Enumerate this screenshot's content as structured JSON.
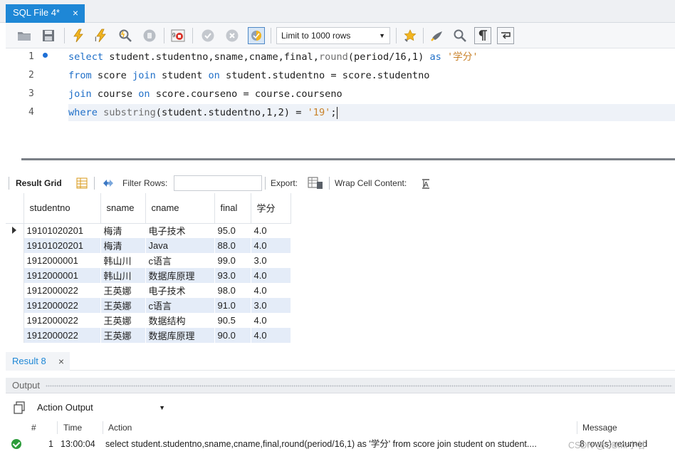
{
  "tab": {
    "title": "SQL File 4*",
    "close": "×"
  },
  "toolbar": {
    "limit_value": "Limit to 1000 rows"
  },
  "editor": {
    "line_numbers": [
      "1",
      "2",
      "3",
      "4"
    ],
    "lines": [
      [
        {
          "t": "select",
          "c": "kw"
        },
        {
          "t": " student.studentno,sname,cname,final,",
          "c": ""
        },
        {
          "t": "round",
          "c": "fn"
        },
        {
          "t": "(period/16,1) ",
          "c": ""
        },
        {
          "t": "as",
          "c": "kw"
        },
        {
          "t": " ",
          "c": ""
        },
        {
          "t": "'学分'",
          "c": "str"
        }
      ],
      [
        {
          "t": "from",
          "c": "kw"
        },
        {
          "t": " score ",
          "c": ""
        },
        {
          "t": "join",
          "c": "kw"
        },
        {
          "t": " student ",
          "c": ""
        },
        {
          "t": "on",
          "c": "kw"
        },
        {
          "t": " student.studentno = score.studentno",
          "c": ""
        }
      ],
      [
        {
          "t": "join",
          "c": "kw"
        },
        {
          "t": " course ",
          "c": ""
        },
        {
          "t": "on",
          "c": "kw"
        },
        {
          "t": " score.courseno = course.courseno",
          "c": ""
        }
      ],
      [
        {
          "t": "where",
          "c": "kw"
        },
        {
          "t": " ",
          "c": ""
        },
        {
          "t": "substring",
          "c": "fn"
        },
        {
          "t": "(student.studentno,1,2) = ",
          "c": ""
        },
        {
          "t": "'19'",
          "c": "str"
        },
        {
          "t": ";",
          "c": ""
        }
      ]
    ]
  },
  "result_toolbar": {
    "result_grid": "Result Grid",
    "filter_rows": "Filter Rows:",
    "export": "Export:",
    "wrap": "Wrap Cell Content:"
  },
  "grid": {
    "columns": [
      "studentno",
      "sname",
      "cname",
      "final",
      "学分"
    ],
    "rows": [
      [
        "19101020201",
        "梅清",
        "电子技术",
        "95.0",
        "4.0"
      ],
      [
        "19101020201",
        "梅清",
        "Java",
        "88.0",
        "4.0"
      ],
      [
        "1912000001",
        "韩山川",
        "c语言",
        "99.0",
        "3.0"
      ],
      [
        "1912000001",
        "韩山川",
        "数据库原理",
        "93.0",
        "4.0"
      ],
      [
        "1912000022",
        "王英娜",
        "电子技术",
        "98.0",
        "4.0"
      ],
      [
        "1912000022",
        "王英娜",
        "c语言",
        "91.0",
        "3.0"
      ],
      [
        "1912000022",
        "王英娜",
        "数据结构",
        "90.5",
        "4.0"
      ],
      [
        "1912000022",
        "王英娜",
        "数据库原理",
        "90.0",
        "4.0"
      ]
    ]
  },
  "result_tab": {
    "label": "Result 8",
    "close": "×"
  },
  "output": {
    "header": "Output",
    "selector": "Action Output",
    "columns": {
      "num": "#",
      "time": "Time",
      "action": "Action",
      "message": "Message"
    },
    "row": {
      "num": "1",
      "time": "13:00:04",
      "action": "select student.studentno,sname,cname,final,round(period/16,1) as '学分'  from score join student on student....",
      "message": "8 row(s) returned"
    },
    "watermark": "CSDN @GBMr小甘"
  },
  "colors": {
    "accent": "#1e87d6",
    "keyword": "#1f6fc8",
    "string": "#c9822a",
    "row_alt": "#e4ecf8",
    "ok": "#2c9c3a"
  }
}
